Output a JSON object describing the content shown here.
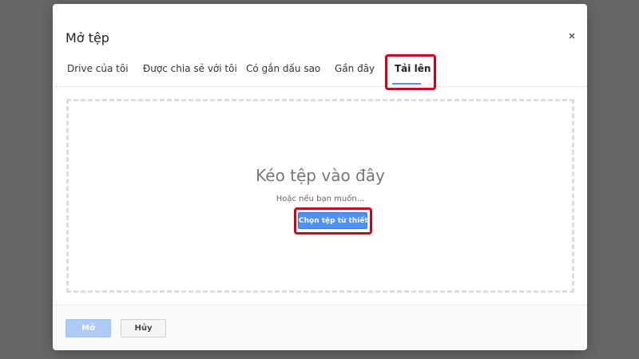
{
  "dialog": {
    "title": "Mở tệp",
    "close_icon": "close-icon"
  },
  "tabs": [
    {
      "label": "Drive của tôi",
      "active": false
    },
    {
      "label": "Được chia sẻ với tôi",
      "active": false
    },
    {
      "label": "Có gắn dấu sao",
      "active": false
    },
    {
      "label": "Gần đây",
      "active": false
    },
    {
      "label": "Tải lên",
      "active": true
    }
  ],
  "dropzone": {
    "title": "Kéo tệp vào đây",
    "or_text": "Hoặc nếu bạn muốn...",
    "choose_button": "Chọn tệp từ thiết bị"
  },
  "footer": {
    "open_button": "Mở",
    "cancel_button": "Hủy"
  },
  "colors": {
    "accent": "#4d90fe",
    "highlight": "#d0021b",
    "overlay": "#666666"
  }
}
